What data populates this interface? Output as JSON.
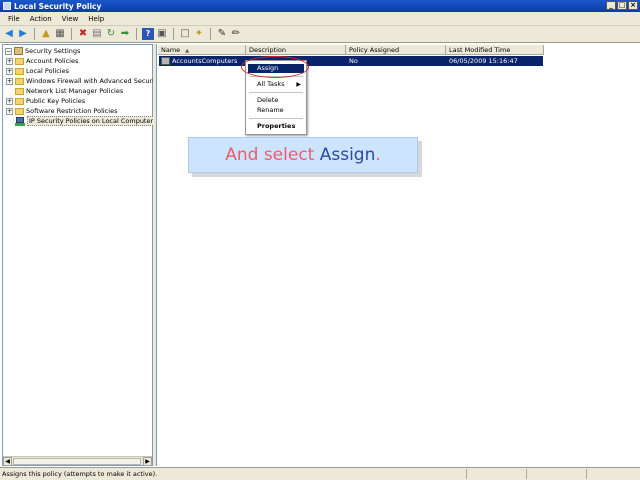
{
  "window": {
    "title": "Local Security Policy",
    "controls": [
      "_",
      "□",
      "×"
    ]
  },
  "menu": [
    "File",
    "Action",
    "View",
    "Help"
  ],
  "tree": {
    "items": [
      {
        "label": "Security Settings",
        "expander": "−",
        "icon": "root"
      },
      {
        "label": "Account Policies",
        "expander": "+",
        "icon": "folder"
      },
      {
        "label": "Local Policies",
        "expander": "+",
        "icon": "folder"
      },
      {
        "label": "Windows Firewall with Advanced Security",
        "expander": "+",
        "icon": "folder"
      },
      {
        "label": "Network List Manager Policies",
        "expander": "",
        "icon": "folder"
      },
      {
        "label": "Public Key Policies",
        "expander": "+",
        "icon": "folder"
      },
      {
        "label": "Software Restriction Policies",
        "expander": "+",
        "icon": "folder"
      },
      {
        "label": "IP Security Policies on Local Computer",
        "expander": "",
        "icon": "ipsec",
        "selected": true
      }
    ]
  },
  "list": {
    "columns": [
      "Name",
      "Description",
      "Policy Assigned",
      "Last Modified Time"
    ],
    "sort_indicator": "▲",
    "rows": [
      {
        "name": "AccountsComputers",
        "description": "",
        "assigned": "No",
        "modified": "06/05/2009 15:16:47"
      }
    ]
  },
  "context_menu": {
    "assign": "Assign",
    "all_tasks": "All Tasks",
    "delete": "Delete",
    "rename": "Rename",
    "properties": "Properties",
    "submenu_arrow": "▶"
  },
  "callout": {
    "part1": "And select ",
    "part2": "Assign",
    "part3": "."
  },
  "status": {
    "text": "Assigns this policy (attempts to make it active)."
  },
  "colors": {
    "selection": "#0a246a",
    "callout_bg": "#cde4ff",
    "callout_pink": "#ef5b6b",
    "callout_blue": "#2b49a5",
    "highlight_circle": "#d22a2a"
  }
}
